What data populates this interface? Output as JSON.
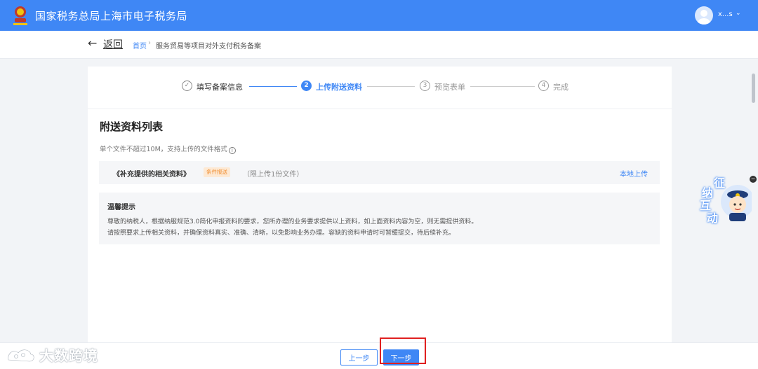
{
  "header": {
    "app_title": "国家税务总局上海市电子税务局",
    "username": "x...s",
    "user_chevron": "⌄",
    "emblem_icon": "tax-emblem",
    "brand_color": "#3f87f5"
  },
  "breadcrumb": {
    "back_arrow": "←",
    "back_label": "返回",
    "home": "首页",
    "separator": "›",
    "current": "服务贸易等项目对外支付税务备案"
  },
  "steps": [
    {
      "num": "✓",
      "label": "填写备案信息",
      "state": "done"
    },
    {
      "num": "2",
      "label": "上传附送资料",
      "state": "active"
    },
    {
      "num": "3",
      "label": "预览表单",
      "state": "todo"
    },
    {
      "num": "4",
      "label": "完成",
      "state": "todo"
    }
  ],
  "main": {
    "section_title": "附送资料列表",
    "hint": "单个文件不超过10M，支持上传的文件格式",
    "info_icon": "i",
    "file_item": {
      "name": "《补充提供的相关资料》",
      "badge": "条件报送",
      "limit": "（限上传1份文件）",
      "upload_label": "本地上传"
    },
    "tip": {
      "title": "温馨提示",
      "line1": "尊敬的纳税人，根据纳服规范3.0简化申报资料的要求，您所办理的业务要求提供以上资料，如上面资料内容为空，则无需提供资料。",
      "line2": "请按照要求上传相关资料，并确保资料真实、准确、清晰，以免影响业务办理。容缺的资料申请时可暂缓提交，待后续补充。"
    }
  },
  "footer": {
    "prev_label": "上一步",
    "next_label": "下一步"
  },
  "float_widget": {
    "chars": [
      "征",
      "纳",
      "互",
      "动"
    ],
    "close_icon": "−"
  },
  "watermark": {
    "text": "大数跨境"
  }
}
